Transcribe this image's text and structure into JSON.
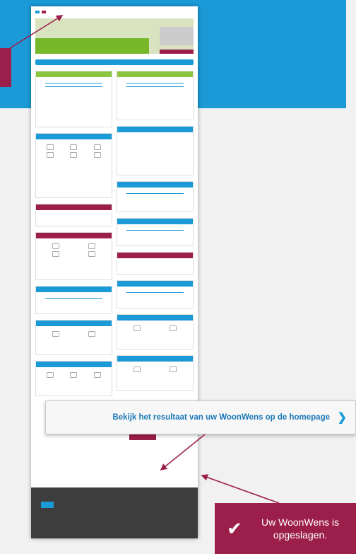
{
  "banner": {
    "text": "Bekijk het resultaat van uw WoonWens op de homepage"
  },
  "toast": {
    "message": "Uw WoonWens is opgeslagen."
  },
  "colors": {
    "blue": "#1a9ad6",
    "crimson": "#9c1f4b",
    "green": "#8cc63f"
  },
  "icons": {
    "banner": "chevron-right-icon",
    "toast": "checkmark-icon"
  }
}
